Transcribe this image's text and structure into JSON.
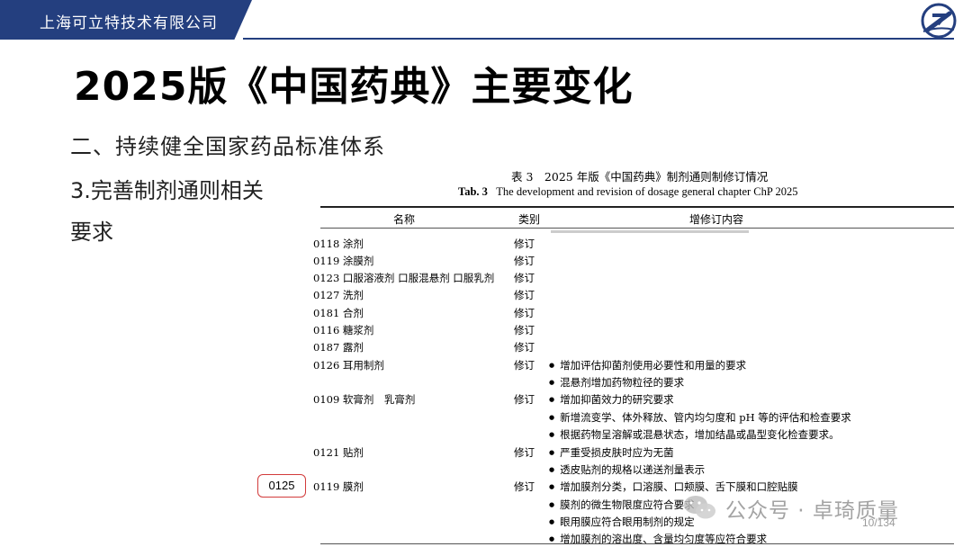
{
  "header": {
    "company": "上海可立特技术有限公司"
  },
  "title": "2025版《中国药典》主要变化",
  "section": {
    "line1": "二、持续健全国家药品标准体系",
    "line2": "3.完善制剂通则相关",
    "line3": "要求"
  },
  "table": {
    "caption_cn": "表 3　2025 年版《中国药典》制剂通则制修订情况",
    "caption_en_label": "Tab. 3",
    "caption_en_text": "The development and revision of dosage general chapter ChP 2025",
    "columns": [
      "名称",
      "类别",
      "增修订内容"
    ],
    "rows": [
      {
        "name": "0118 涂剂",
        "type": "修订"
      },
      {
        "name": "0119 涂膜剂",
        "type": "修订"
      },
      {
        "name": "0123 口服溶液剂 口服混悬剂 口服乳剂",
        "type": "修订"
      },
      {
        "name": "0127 洗剂",
        "type": "修订"
      },
      {
        "name": "0181 合剂",
        "type": "修订"
      },
      {
        "name": "0116 糖浆剂",
        "type": "修订"
      },
      {
        "name": "0187 露剂",
        "type": "修订"
      },
      {
        "name": "0126 耳用制剂",
        "type": "修订"
      },
      {
        "name": "0109 软膏剂　乳膏剂",
        "type": "修订"
      },
      {
        "name": "0121 贴剂",
        "type": "修订"
      },
      {
        "name": "0119 膜剂",
        "type": "修订"
      }
    ],
    "bullets": [
      "增加评估抑菌剂使用必要性和用量的要求",
      "混悬剂增加药物粒径的要求",
      "增加抑菌效力的研究要求",
      "新增流变学、体外释放、管内均匀度和 pH 等的评估和检查要求",
      "根据药物呈溶解或混悬状态，增加结晶或晶型变化检查要求。",
      "严重受损皮肤时应为无菌",
      "透皮贴剂的规格以递送剂量表示",
      "增加膜剂分类，口溶膜、口颊膜、舌下膜和口腔贴膜",
      "膜剂的微生物限度应符合要求",
      "眼用膜应符合眼用制剂的规定",
      "增加膜剂的溶出度、含量均匀度等应符合要求"
    ]
  },
  "annotation": {
    "label": "0125"
  },
  "watermark": {
    "text": "公众号 · 卓琦质量"
  },
  "page_number": "10/134",
  "colors": {
    "brand": "#243F7F",
    "annotation_border": "#D23B3B"
  }
}
